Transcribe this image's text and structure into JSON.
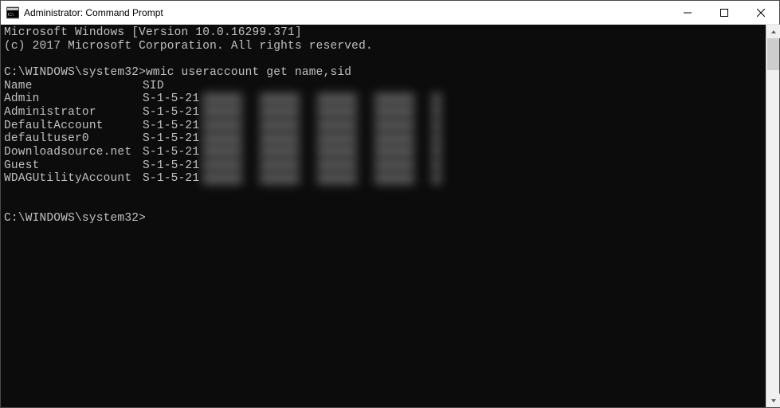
{
  "window": {
    "title": "Administrator: Command Prompt"
  },
  "terminal": {
    "line_version": "Microsoft Windows [Version 10.0.16299.371]",
    "line_copyright": "(c) 2017 Microsoft Corporation. All rights reserved.",
    "prompt1_path": "C:\\WINDOWS\\system32>",
    "command1": "wmic useraccount get name,sid",
    "header_name": "Name",
    "header_sid": "SID",
    "rows": [
      {
        "name": "Admin",
        "sid": "S-1-5-21"
      },
      {
        "name": "Administrator",
        "sid": "S-1-5-21"
      },
      {
        "name": "DefaultAccount",
        "sid": "S-1-5-21"
      },
      {
        "name": "defaultuser0",
        "sid": "S-1-5-21"
      },
      {
        "name": "Downloadsource.net",
        "sid": "S-1-5-21"
      },
      {
        "name": "Guest",
        "sid": "S-1-5-21"
      },
      {
        "name": "WDAGUtilityAccount",
        "sid": "S-1-5-21"
      }
    ],
    "prompt2_path": "C:\\WINDOWS\\system32>"
  }
}
